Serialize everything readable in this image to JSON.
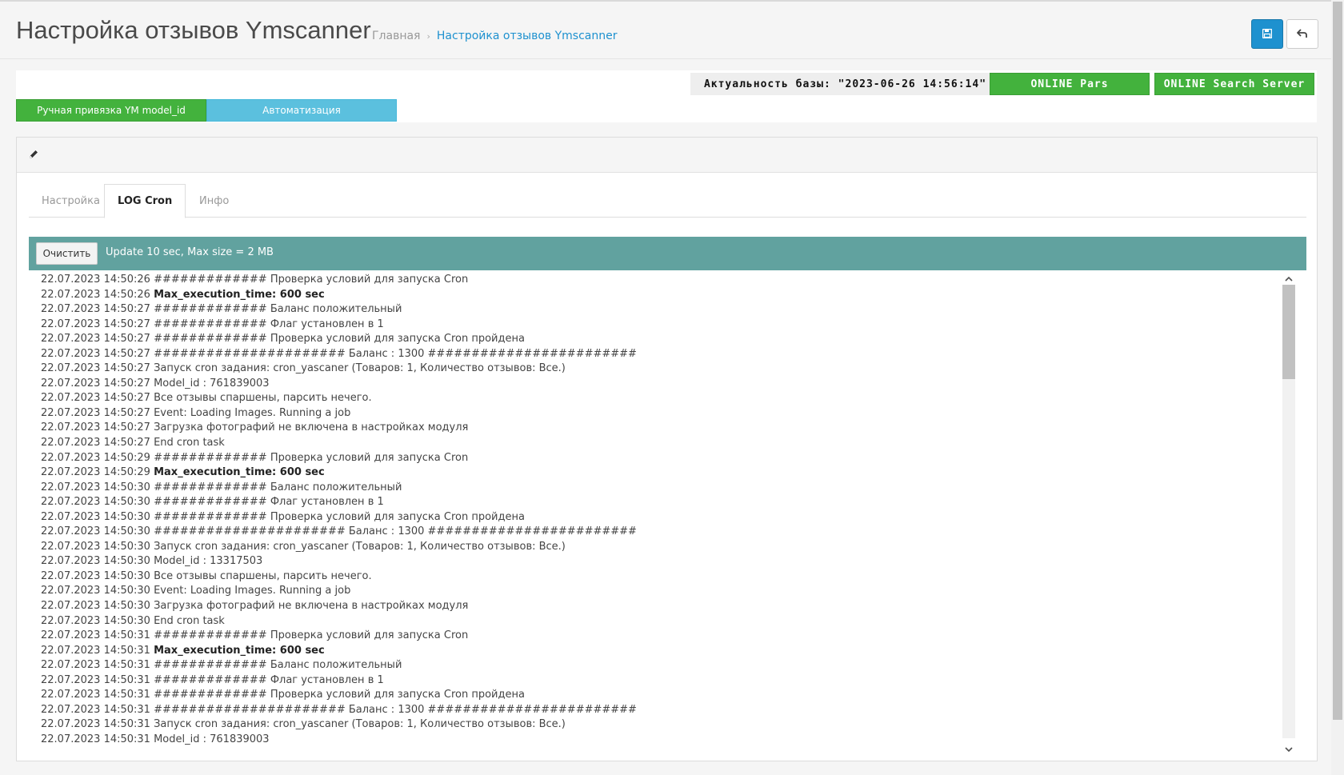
{
  "header": {
    "title": "Настройка отзывов Ymscanner",
    "breadcrumb": {
      "home": "Главная",
      "separator": "›",
      "current": "Настройка отзывов Ymscanner"
    }
  },
  "status": {
    "db_actuality": "Актуальность базы: \"2023-06-26 14:56:14\"",
    "online_pars": "ONLINE Pars",
    "online_search": "ONLINE Search Server"
  },
  "mode_tabs": {
    "manual": "Ручная привязка YM model_id",
    "auto": "Автоматизация"
  },
  "tabs": [
    "Настройка",
    "LOG Cron",
    "Инфо"
  ],
  "active_tab": "LOG Cron",
  "log": {
    "clear_label": "Очистить",
    "update_info": "Update 10 sec, Max size = 2 MB",
    "lines": [
      {
        "time": "22.07.2023 14:50:26",
        "text": "############# Проверка условий для запуска Cron",
        "bold": false
      },
      {
        "time": "22.07.2023 14:50:26",
        "text": "Max_execution_time: 600 sec",
        "bold": true
      },
      {
        "time": "22.07.2023 14:50:27",
        "text": "############# Баланс положительный",
        "bold": false
      },
      {
        "time": "22.07.2023 14:50:27",
        "text": "############# Флаг установлен в 1",
        "bold": false
      },
      {
        "time": "22.07.2023 14:50:27",
        "text": "############# Проверка условий для запуска Cron пройдена",
        "bold": false
      },
      {
        "time": "22.07.2023 14:50:27",
        "text": "###################### Баланс : 1300 ########################",
        "bold": false
      },
      {
        "time": "22.07.2023 14:50:27",
        "text": "Запуск cron задания: cron_yascaner (Товаров: 1, Количество отзывов: Все.)",
        "bold": false
      },
      {
        "time": "22.07.2023 14:50:27",
        "text": "Model_id : 761839003",
        "bold": false
      },
      {
        "time": "22.07.2023 14:50:27",
        "text": "Все отзывы спаршены, парсить нечего.",
        "bold": false
      },
      {
        "time": "22.07.2023 14:50:27",
        "text": "Event: Loading Images. Running a job",
        "bold": false
      },
      {
        "time": "22.07.2023 14:50:27",
        "text": "Загрузка фотографий не включена в настройках модуля",
        "bold": false
      },
      {
        "time": "22.07.2023 14:50:27",
        "text": "End cron task",
        "bold": false
      },
      {
        "time": "22.07.2023 14:50:29",
        "text": "############# Проверка условий для запуска Cron",
        "bold": false
      },
      {
        "time": "22.07.2023 14:50:29",
        "text": "Max_execution_time: 600 sec",
        "bold": true
      },
      {
        "time": "22.07.2023 14:50:30",
        "text": "############# Баланс положительный",
        "bold": false
      },
      {
        "time": "22.07.2023 14:50:30",
        "text": "############# Флаг установлен в 1",
        "bold": false
      },
      {
        "time": "22.07.2023 14:50:30",
        "text": "############# Проверка условий для запуска Cron пройдена",
        "bold": false
      },
      {
        "time": "22.07.2023 14:50:30",
        "text": "###################### Баланс : 1300 ########################",
        "bold": false
      },
      {
        "time": "22.07.2023 14:50:30",
        "text": "Запуск cron задания: cron_yascaner (Товаров: 1, Количество отзывов: Все.)",
        "bold": false
      },
      {
        "time": "22.07.2023 14:50:30",
        "text": "Model_id : 13317503",
        "bold": false
      },
      {
        "time": "22.07.2023 14:50:30",
        "text": "Все отзывы спаршены, парсить нечего.",
        "bold": false
      },
      {
        "time": "22.07.2023 14:50:30",
        "text": "Event: Loading Images. Running a job",
        "bold": false
      },
      {
        "time": "22.07.2023 14:50:30",
        "text": "Загрузка фотографий не включена в настройках модуля",
        "bold": false
      },
      {
        "time": "22.07.2023 14:50:30",
        "text": "End cron task",
        "bold": false
      },
      {
        "time": "22.07.2023 14:50:31",
        "text": "############# Проверка условий для запуска Cron",
        "bold": false
      },
      {
        "time": "22.07.2023 14:50:31",
        "text": "Max_execution_time: 600 sec",
        "bold": true
      },
      {
        "time": "22.07.2023 14:50:31",
        "text": "############# Баланс положительный",
        "bold": false
      },
      {
        "time": "22.07.2023 14:50:31",
        "text": "############# Флаг установлен в 1",
        "bold": false
      },
      {
        "time": "22.07.2023 14:50:31",
        "text": "############# Проверка условий для запуска Cron пройдена",
        "bold": false
      },
      {
        "time": "22.07.2023 14:50:31",
        "text": "###################### Баланс : 1300 ########################",
        "bold": false
      },
      {
        "time": "22.07.2023 14:50:31",
        "text": "Запуск cron задания: cron_yascaner (Товаров: 1, Количество отзывов: Все.)",
        "bold": false
      },
      {
        "time": "22.07.2023 14:50:31",
        "text": "Model_id : 761839003",
        "bold": false
      }
    ]
  },
  "icons": {
    "save": "floppy-disk-icon",
    "back": "reply-arrow-icon",
    "edit": "pencil-icon",
    "scroll_up": "chevron-up-icon",
    "scroll_down": "chevron-down-icon"
  },
  "colors": {
    "primary": "#1e91cf",
    "success": "#43b23d",
    "info": "#5bc0de",
    "log_toolbar": "#61a29f"
  }
}
